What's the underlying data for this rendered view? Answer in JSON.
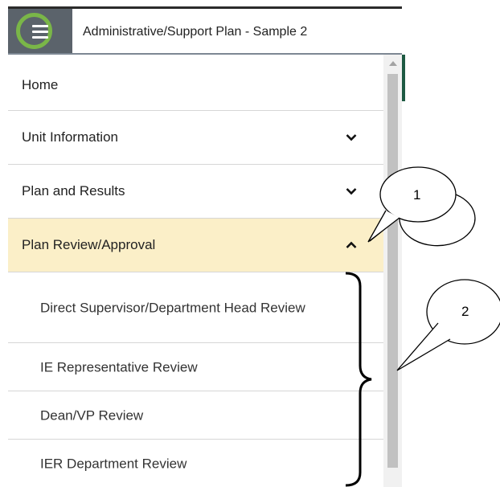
{
  "header": {
    "title": "Administrative/Support Plan - Sample 2",
    "menu_icon": "hamburger-icon"
  },
  "menu": {
    "items": [
      {
        "label": "Home"
      },
      {
        "label": "Unit Information",
        "chevron": "down"
      },
      {
        "label": "Plan and Results",
        "chevron": "down"
      },
      {
        "label": "Plan Review/Approval",
        "chevron": "up",
        "active": true
      }
    ],
    "sub_items": [
      {
        "label": "Direct Supervisor/Department Head Review"
      },
      {
        "label": "IE Representative Review"
      },
      {
        "label": "Dean/VP Review"
      },
      {
        "label": "IER Department Review"
      }
    ]
  },
  "callouts": {
    "one": "1",
    "two": "2"
  },
  "colors": {
    "highlight_ring": "#7ab648",
    "active_row": "#fbefc8",
    "header_button": "#5b636b"
  }
}
